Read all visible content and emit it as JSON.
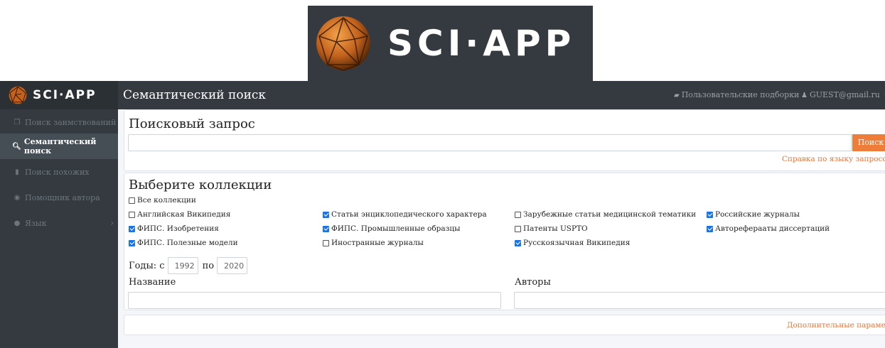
{
  "banner": {
    "brand": "SCI·APP"
  },
  "sidebar": {
    "brand": "SCI·APP",
    "items": [
      {
        "label": "Поиск заимствований",
        "icon": "copy-icon",
        "glyph": "❐",
        "active": false
      },
      {
        "label": "Семантический поиск",
        "icon": "search-icon",
        "glyph": "🔍︎",
        "active": true
      },
      {
        "label": "Поиск похожих",
        "icon": "file-icon",
        "glyph": "▮",
        "active": false
      },
      {
        "label": "Помощник автора",
        "icon": "eye-icon",
        "glyph": "◉",
        "active": false
      },
      {
        "label": "Язык",
        "icon": "globe-icon",
        "glyph": "●",
        "active": false,
        "chevron": "›"
      }
    ]
  },
  "topbar": {
    "title": "Семантический поиск",
    "collections_link": "Пользовательские подборки",
    "user": "GUEST@gmail.ru"
  },
  "search_card": {
    "title": "Поисковый запрос",
    "query_value": "",
    "search_button": "Поиск",
    "help_link": "Справка по языку запросов"
  },
  "collections_card": {
    "title": "Выберите коллекции",
    "all_label": "Все коллекции",
    "all_checked": false,
    "columns": [
      [
        {
          "label": "Английская Википедия",
          "checked": false
        },
        {
          "label": "ФИПС. Изобретения",
          "checked": true
        },
        {
          "label": "ФИПС. Полезные модели",
          "checked": true
        }
      ],
      [
        {
          "label": "Статьи энциклопедического характера",
          "checked": true
        },
        {
          "label": "ФИПС. Промышленные образцы",
          "checked": true
        },
        {
          "label": "Иностранные журналы",
          "checked": false
        }
      ],
      [
        {
          "label": "Зарубежные статьи медицинской тематики",
          "checked": false
        },
        {
          "label": "Патенты USPTO",
          "checked": false
        },
        {
          "label": "Русскоязычная Википедия",
          "checked": true
        }
      ],
      [
        {
          "label": "Российские журналы",
          "checked": true
        },
        {
          "label": "Автореферааты диссертаций",
          "checked": true
        }
      ]
    ],
    "years_label": "Годы: с",
    "years_to": "по",
    "year_from_placeholder": "1992",
    "year_to_placeholder": "2020",
    "title_label": "Название",
    "authors_label": "Авторы"
  },
  "extra_card": {
    "link": "Дополнительные параметры"
  },
  "colors": {
    "accent": "#ee7d3a",
    "dark": "#343a40",
    "checkbox": "#1a73e8"
  }
}
